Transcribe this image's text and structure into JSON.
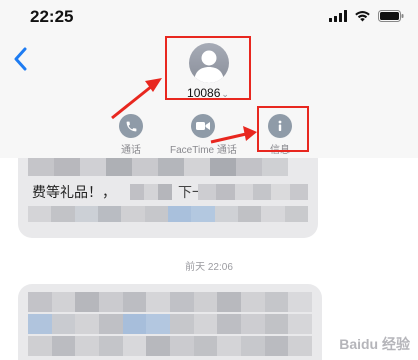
{
  "status_bar": {
    "time": "22:25"
  },
  "contact": {
    "name": "10086"
  },
  "actions": [
    {
      "label": "通话"
    },
    {
      "label": "FaceTime 通话"
    },
    {
      "label": "信息"
    }
  ],
  "messages": {
    "line1": "费等礼品！，",
    "line2": "下一",
    "timestamp": "前天 22:06"
  },
  "watermark": {
    "text": "Baidu 经验"
  },
  "colors": {
    "accent": "#e8271f",
    "ios_blue": "#1e7cf2",
    "bubble_gray": "#e9e9eb"
  }
}
